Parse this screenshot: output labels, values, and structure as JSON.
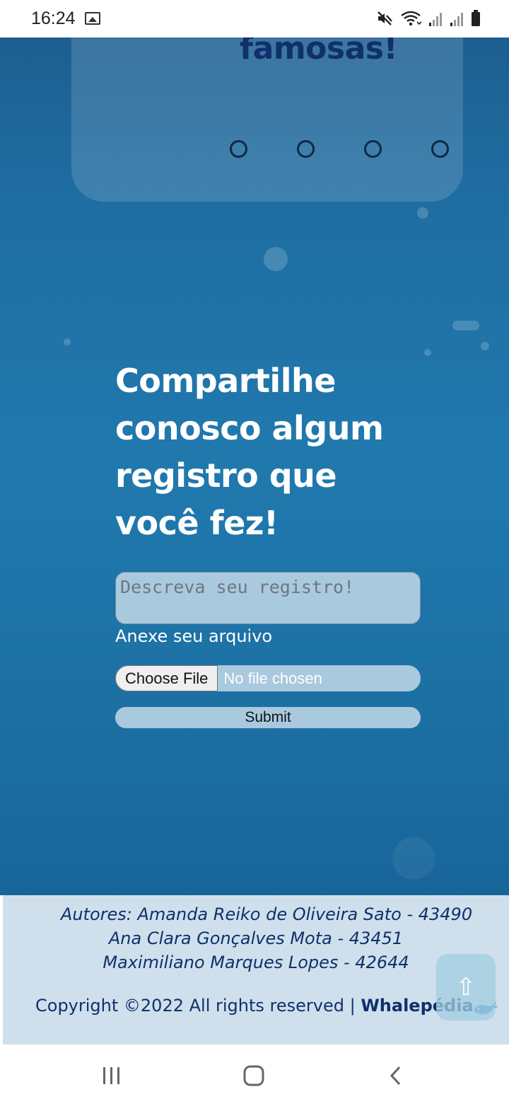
{
  "status_bar": {
    "time": "16:24",
    "icons": [
      "image-icon",
      "mute-icon",
      "wifi-icon",
      "signal-icon",
      "signal-icon",
      "battery-icon"
    ]
  },
  "carousel": {
    "title": "famosas!",
    "dot_count": 4
  },
  "share": {
    "heading_lines": [
      "Compartilhe",
      "conosco algum",
      "registro que",
      "você fez!"
    ]
  },
  "form": {
    "description_placeholder": "Descreva seu registro!",
    "attach_label": "Anexe seu arquivo",
    "choose_file_label": "Choose File",
    "file_status": "No file chosen",
    "submit_label": "Submit"
  },
  "footer": {
    "authors_line1": "Autores: Amanda Reiko de Oliveira Sato - 43490",
    "authors_line2": "Ana Clara Gonçalves Mota - 43451",
    "authors_line3": "Maximiliano Marques Lopes - 42644",
    "copyright_text": "Copyright ©2022 All rights reserved | ",
    "brand": "Whalepédia",
    "back_to_top_icon": "⇧"
  },
  "colors": {
    "ocean_blue": "#1f6ea3",
    "navy_text": "#10306b",
    "input_bg": "#a9c9de",
    "footer_bg": "#cfe0ec"
  }
}
